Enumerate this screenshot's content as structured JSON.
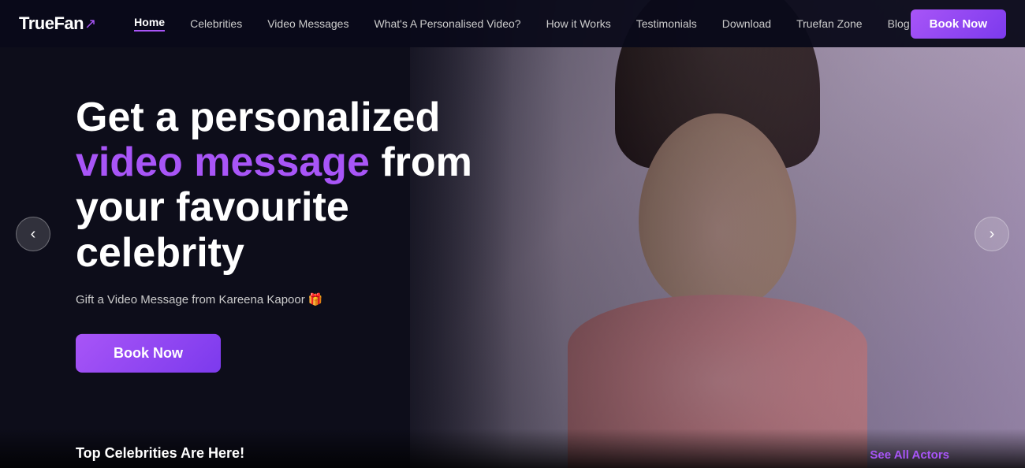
{
  "logo": {
    "text": "TrueFan",
    "mark": "↗"
  },
  "nav": {
    "links": [
      {
        "id": "home",
        "label": "Home",
        "active": true
      },
      {
        "id": "celebrities",
        "label": "Celebrities",
        "active": false
      },
      {
        "id": "video-messages",
        "label": "Video Messages",
        "active": false
      },
      {
        "id": "whats-personalised",
        "label": "What's A Personalised Video?",
        "active": false
      },
      {
        "id": "how-it-works",
        "label": "How it Works",
        "active": false
      },
      {
        "id": "testimonials",
        "label": "Testimonials",
        "active": false
      },
      {
        "id": "download",
        "label": "Download",
        "active": false
      },
      {
        "id": "truefan-zone",
        "label": "Truefan Zone",
        "active": false
      },
      {
        "id": "blog",
        "label": "Blog",
        "active": false
      }
    ],
    "book_now": "Book Now"
  },
  "hero": {
    "title_part1": "Get a personalized ",
    "title_highlight": "video message",
    "title_part2": " from your favourite celebrity",
    "subtitle": "Gift a Video Message from Kareena Kapoor 🎁",
    "book_btn": "Book Now",
    "left_arrow": "‹",
    "right_arrow": "›"
  },
  "bottom": {
    "left_text": "Top Celebrities Are Here!",
    "right_text": "See All Actors"
  },
  "colors": {
    "accent": "#a855f7",
    "dark_bg": "#0d0d1a",
    "highlight": "#a855f7"
  }
}
